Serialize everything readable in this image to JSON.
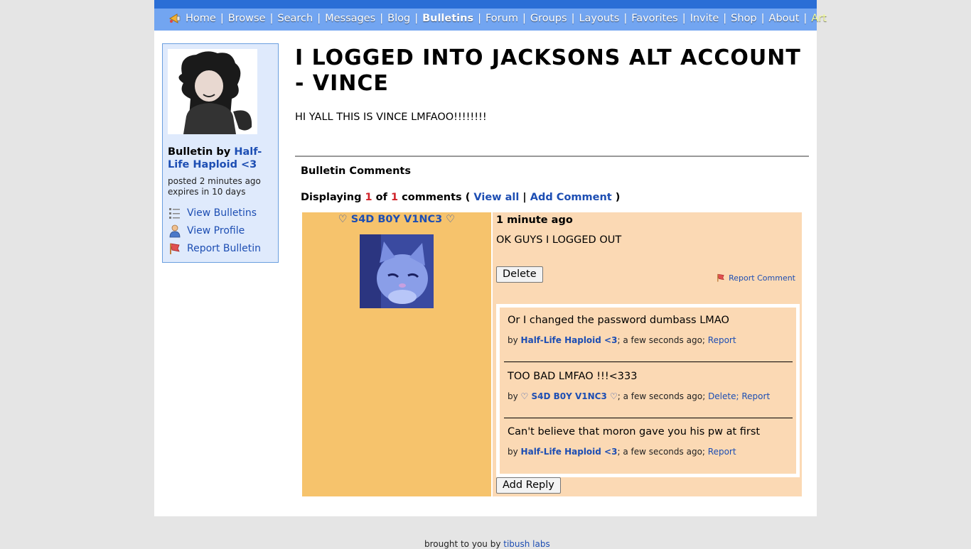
{
  "nav": {
    "items": [
      {
        "label": "Home",
        "active": false
      },
      {
        "label": "Browse",
        "active": false
      },
      {
        "label": "Search",
        "active": false
      },
      {
        "label": "Messages",
        "active": false
      },
      {
        "label": "Blog",
        "active": false
      },
      {
        "label": "Bulletins",
        "active": true
      },
      {
        "label": "Forum",
        "active": false
      },
      {
        "label": "Groups",
        "active": false
      },
      {
        "label": "Layouts",
        "active": false
      },
      {
        "label": "Favorites",
        "active": false
      },
      {
        "label": "Invite",
        "active": false
      },
      {
        "label": "Shop",
        "active": false
      },
      {
        "label": "About",
        "active": false
      },
      {
        "label": "Art",
        "active": false
      }
    ],
    "separator": "|"
  },
  "sidebar": {
    "bulletin_by_label": "Bulletin by",
    "author": "Half-Life Haploid <3",
    "posted": "posted 2 minutes ago",
    "expires": "expires in 10 days",
    "links": [
      {
        "label": "View Bulletins",
        "icon": "list-icon"
      },
      {
        "label": "View Profile",
        "icon": "user-icon"
      },
      {
        "label": "Report Bulletin",
        "icon": "report-flag-icon"
      }
    ]
  },
  "bulletin": {
    "title": "I LOGGED INTO JACKSONS ALT ACCOUNT - VINCE",
    "body": "HI YALL THIS IS VINCE LMFAOO!!!!!!!!"
  },
  "comments": {
    "heading": "Bulletin Comments",
    "displaying_label": "Displaying",
    "shown": "1",
    "of_label": "of",
    "total": "1",
    "comments_label": "comments (",
    "view_all": "View all",
    "add_comment": "Add Comment",
    "close_paren": ")",
    "items": [
      {
        "author": "♡ S4D B0Y V1NC3 ♡",
        "time": "1 minute ago",
        "text": "OK GUYS I LOGGED OUT",
        "delete_label": "Delete",
        "report_label": "Report Comment",
        "add_reply_label": "Add Reply",
        "replies": [
          {
            "text": "Or I changed the password dumbass LMAO",
            "by": "by",
            "author": "Half-Life Haploid <3",
            "time": "; a few seconds ago;",
            "actions": [
              "Report"
            ]
          },
          {
            "text": "TOO BAD LMFAO !!!<333",
            "by": "by",
            "author": "♡ S4D B0Y V1NC3 ♡",
            "time": "; a few seconds ago;",
            "actions": [
              "Delete;",
              "Report"
            ]
          },
          {
            "text": "Can't believe that moron gave you his pw at first",
            "by": "by",
            "author": "Half-Life Haploid <3",
            "time": "; a few seconds ago;",
            "actions": [
              "Report"
            ]
          }
        ]
      }
    ]
  },
  "footer": {
    "text": "brought to you by",
    "link": "tibush labs"
  },
  "colors": {
    "nav_bg": "#72a5f1",
    "link": "#1d4eb3",
    "comment_left_bg": "#f6c36c",
    "comment_right_bg": "#fbd9b4",
    "sidebar_bg": "#dfeafc"
  }
}
